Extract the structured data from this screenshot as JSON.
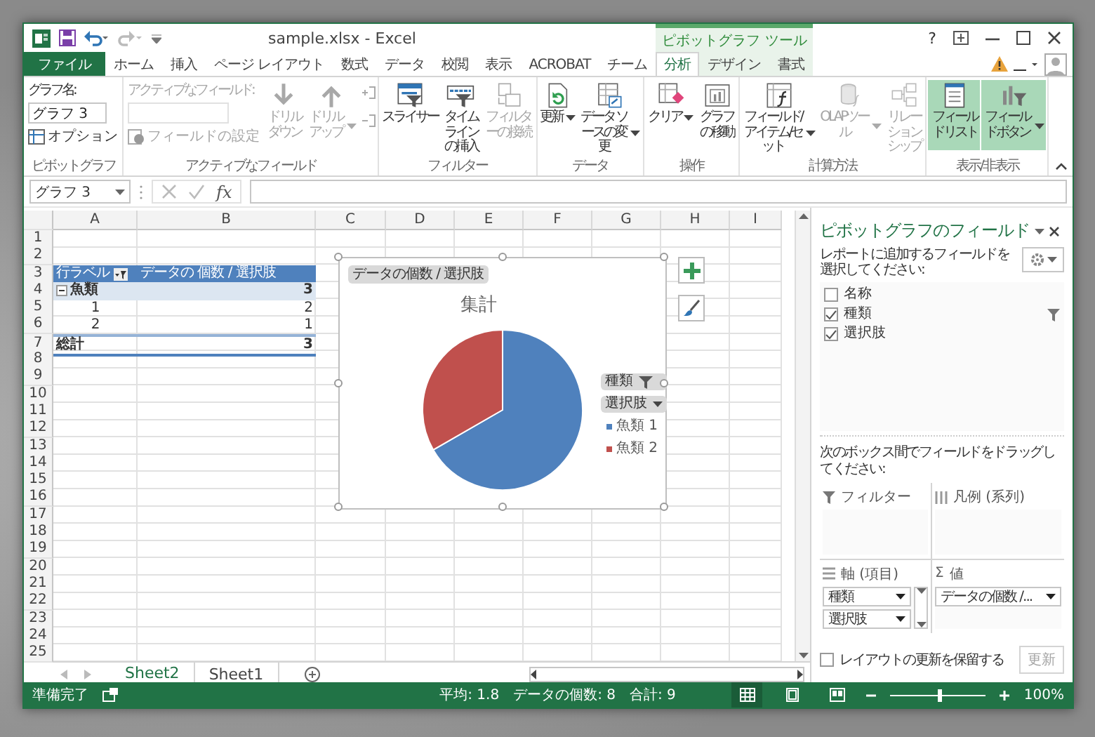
{
  "window": {
    "title": "sample.xlsx - Excel",
    "contextual_group": "ピボットグラフ ツール",
    "help": "?"
  },
  "tabs": [
    {
      "label": "ファイル",
      "kind": "file",
      "selected": false
    },
    {
      "label": "ホーム",
      "kind": "normal",
      "selected": false
    },
    {
      "label": "挿入",
      "kind": "normal",
      "selected": false
    },
    {
      "label": "ページ レイアウト",
      "kind": "normal",
      "selected": false
    },
    {
      "label": "数式",
      "kind": "normal",
      "selected": false
    },
    {
      "label": "データ",
      "kind": "normal",
      "selected": false
    },
    {
      "label": "校閲",
      "kind": "normal",
      "selected": false
    },
    {
      "label": "表示",
      "kind": "normal",
      "selected": false
    },
    {
      "label": "ACROBAT",
      "kind": "normal",
      "selected": false
    },
    {
      "label": "チーム",
      "kind": "normal",
      "selected": false
    },
    {
      "label": "分析",
      "kind": "contextual",
      "selected": true
    },
    {
      "label": "デザイン",
      "kind": "contextual",
      "selected": false
    },
    {
      "label": "書式",
      "kind": "contextual",
      "selected": false
    }
  ],
  "ribbon": {
    "groups": [
      {
        "label": "ピボットグラフ",
        "kind": "chart_name",
        "name_label": "グラフ名:",
        "name_value": "グラフ 3",
        "options": "オプション"
      },
      {
        "label": "アクティブなフィールド",
        "kind": "active_field",
        "field_label": "アクティブなフィールド:",
        "settings": "フィールドの設定",
        "disabled": true,
        "buttons": [
          {
            "label": "ドリルダウン",
            "kind": "down",
            "disabled": true,
            "on": false,
            "dropdown": false
          },
          {
            "label": "ドリルアップ",
            "kind": "up",
            "disabled": true,
            "on": false,
            "dropdown": true
          }
        ]
      },
      {
        "label": "フィルター",
        "kind": "buttons",
        "buttons": [
          {
            "label": "スライサー",
            "kind": "slicer",
            "disabled": false,
            "on": false,
            "dropdown": false
          },
          {
            "label": "タイムラインの挿入",
            "kind": "timeline",
            "disabled": false,
            "on": false,
            "dropdown": false
          },
          {
            "label": "フィルターの接続",
            "kind": "connections",
            "disabled": true,
            "on": false,
            "dropdown": false
          }
        ]
      },
      {
        "label": "データ",
        "kind": "buttons",
        "buttons": [
          {
            "label": "更新",
            "kind": "refresh",
            "disabled": false,
            "on": false,
            "dropdown": true
          },
          {
            "label": "データ ソースの変更",
            "kind": "source",
            "disabled": false,
            "on": false,
            "dropdown": true
          }
        ]
      },
      {
        "label": "操作",
        "kind": "buttons",
        "buttons": [
          {
            "label": "クリア",
            "kind": "clear",
            "disabled": false,
            "on": false,
            "dropdown": true
          },
          {
            "label": "グラフの移動",
            "kind": "move",
            "disabled": false,
            "on": false,
            "dropdown": false
          }
        ]
      },
      {
        "label": "計算方法",
        "kind": "buttons",
        "buttons": [
          {
            "label": "フィールド/アイテム/セット",
            "kind": "formula",
            "disabled": false,
            "on": false,
            "dropdown": true
          },
          {
            "label": "OLAPツール",
            "kind": "olap",
            "disabled": true,
            "on": false,
            "dropdown": true
          },
          {
            "label": "リレーションシップ",
            "kind": "relations",
            "disabled": true,
            "on": false,
            "dropdown": false
          }
        ]
      },
      {
        "label": "表示/非表示",
        "kind": "buttons",
        "buttons": [
          {
            "label": "フィールドリスト",
            "kind": "list",
            "disabled": false,
            "on": true,
            "dropdown": false
          },
          {
            "label": "フィールドボタン",
            "kind": "fieldbuttons",
            "disabled": false,
            "on": true,
            "dropdown": true
          }
        ]
      }
    ]
  },
  "formula_bar": {
    "name_box": "グラフ 3",
    "function_label": "fx"
  },
  "sheet": {
    "columns": [
      "A",
      "B",
      "C",
      "D",
      "E",
      "F",
      "G",
      "H",
      "I"
    ],
    "rows": [
      {
        "number": "1",
        "kind": "blank"
      },
      {
        "number": "2",
        "kind": "blank"
      },
      {
        "number": "3",
        "kind": "header",
        "cells": [
          "行ラベル",
          "データの 個数 / 選択肢"
        ]
      },
      {
        "number": "4",
        "kind": "group",
        "expanded": true,
        "cells": [
          "魚類",
          "3"
        ]
      },
      {
        "number": "5",
        "kind": "item",
        "cells": [
          "1",
          "2"
        ]
      },
      {
        "number": "6",
        "kind": "item",
        "cells": [
          "2",
          "1"
        ]
      },
      {
        "number": "7",
        "kind": "total",
        "cells": [
          "総計",
          "3"
        ]
      },
      {
        "number": "8",
        "kind": "blank"
      },
      {
        "number": "9",
        "kind": "blank"
      },
      {
        "number": "10",
        "kind": "blank"
      },
      {
        "number": "11",
        "kind": "blank"
      },
      {
        "number": "12",
        "kind": "blank"
      },
      {
        "number": "13",
        "kind": "blank"
      },
      {
        "number": "14",
        "kind": "blank"
      },
      {
        "number": "15",
        "kind": "blank"
      },
      {
        "number": "16",
        "kind": "blank"
      },
      {
        "number": "17",
        "kind": "blank"
      },
      {
        "number": "18",
        "kind": "blank"
      },
      {
        "number": "19",
        "kind": "blank"
      },
      {
        "number": "20",
        "kind": "blank"
      },
      {
        "number": "21",
        "kind": "blank"
      },
      {
        "number": "22",
        "kind": "blank"
      },
      {
        "number": "23",
        "kind": "blank"
      },
      {
        "number": "24",
        "kind": "blank"
      },
      {
        "number": "25",
        "kind": "blank"
      }
    ],
    "chart": {
      "value_button": "データの個数 / 選択肢",
      "axis_buttons": [
        {
          "label": "種類",
          "kind": "filter"
        },
        {
          "label": "選択肢",
          "kind": "dropdown"
        }
      ],
      "legend": [
        {
          "color": "#4f81bd"
        },
        {
          "color": "#c0504d"
        }
      ],
      "chart_data": {
        "type": "pie",
        "title": "集計",
        "categories": [
          "魚類 1",
          "魚類 2"
        ],
        "values": [
          66.67,
          33.33
        ]
      }
    }
  },
  "sheet_tabs": [
    {
      "label": "Sheet2",
      "selected": true
    },
    {
      "label": "Sheet1",
      "selected": false
    }
  ],
  "pane": {
    "title": "ピボットグラフのフィールド",
    "instruction": "レポートに追加するフィールドを選択してください:",
    "fields": [
      {
        "label": "名称",
        "checked": false,
        "filtered": false
      },
      {
        "label": "種類",
        "checked": true,
        "filtered": true
      },
      {
        "label": "選択肢",
        "checked": true,
        "filtered": false
      }
    ],
    "drag_hint": "次のボックス間でフィールドをドラッグしてください:",
    "areas": [
      {
        "label": "フィルター",
        "kind": "filter"
      },
      {
        "label": "凡例 (系列)",
        "kind": "legend"
      },
      {
        "label": "軸 (項目)",
        "kind": "axis",
        "items": [
          "種類",
          "選択肢"
        ]
      },
      {
        "label": "値",
        "kind": "values",
        "symbol": "Σ",
        "items": [
          "データの個数 /..."
        ]
      }
    ],
    "defer": {
      "label": "レイアウトの更新を保留する",
      "checked": false
    },
    "update_button": {
      "label": "更新",
      "disabled": true
    }
  },
  "status": {
    "ready": "準備完了",
    "stats": [
      "平均: 1.8",
      "データの個数: 8",
      "合計: 9"
    ],
    "views": [
      {
        "kind": "normal",
        "selected": true
      },
      {
        "kind": "layout",
        "selected": false
      },
      {
        "kind": "pagebreak",
        "selected": false
      }
    ],
    "zoom": {
      "level": 0.5,
      "label": "100%"
    }
  }
}
